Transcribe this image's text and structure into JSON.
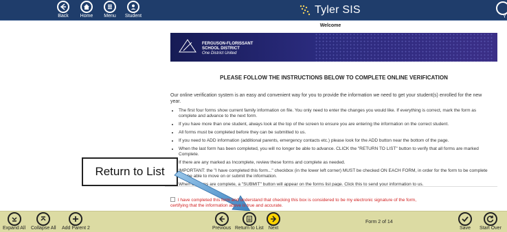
{
  "topnav": [
    {
      "label": "Back",
      "icon": "arrow-left-icon"
    },
    {
      "label": "Home",
      "icon": "home-icon"
    },
    {
      "label": "Menu",
      "icon": "menu-icon"
    },
    {
      "label": "Student",
      "icon": "student-icon"
    }
  ],
  "app_title": "Tyler SIS",
  "top_right_label": "Y",
  "welcome": "Welcome",
  "banner": {
    "line1": "FERGUSON-FLORISSANT",
    "line2": "SCHOOL DISTRICT",
    "line3": "One District United"
  },
  "instructions_title": "PLEASE FOLLOW THE INSTRUCTIONS BELOW TO COMPLETE ONLINE VERIFICATION",
  "intro": "Our online verification system is an easy and convenient way for you to provide the information we need to get your student(s) enrolled for the new year.",
  "bullets": [
    "The first four forms show current family information on file. You only need to enter the changes you would like. If everything is correct, mark the form as complete and advance to the next form.",
    "If you have more than one student, always look at the top of the screen to ensure you are entering the information on the correct student.",
    "All forms must be completed before they can be submitted to us.",
    "If you need to ADD information (additional parents, emergency contacts etc.) please look for the ADD button near the bottom of the page.",
    "When the last form has been completed, you will no longer be able to advance. CLICK the \"RETURN TO LIST\" button to verify that all forms are marked Complete.",
    "If there are any marked as Incomplete, review these forms and complete as needed.",
    "IMPORTANT: the \"I have completed this form...\" checkbox (in the lower left corner) MUST be checked ON EACH FORM, in order for the form to be complete and be able to move on or submit the information.",
    "When all forms are complete, a \"SUBMIT\" button will appear on the forms list page. Click this to send your information to us."
  ],
  "callout": "Return to List",
  "attestation": "I have completed this form and understand that checking this box is considered to be my electronic signature of the form, certifying that the information above is true and accurate.",
  "bottom": {
    "left": [
      {
        "label": "Expand All",
        "icon": "expand-icon"
      },
      {
        "label": "Collapse All",
        "icon": "collapse-icon"
      },
      {
        "label": "Add Parent 2",
        "icon": "add-icon"
      }
    ],
    "center": [
      {
        "label": "Previous",
        "icon": "arrow-left-icon"
      },
      {
        "label": "Return to List",
        "icon": "list-icon"
      },
      {
        "label": "Next",
        "icon": "arrow-right-icon"
      }
    ],
    "form_counter": "Form 2 of 14",
    "right": [
      {
        "label": "Save",
        "icon": "check-icon"
      },
      {
        "label": "Start Over",
        "icon": "refresh-icon"
      }
    ]
  },
  "colors": {
    "topbar": "#1f3d6b",
    "bottombar": "#dcdba3",
    "accent": "#ffd400",
    "red": "#d12020"
  }
}
